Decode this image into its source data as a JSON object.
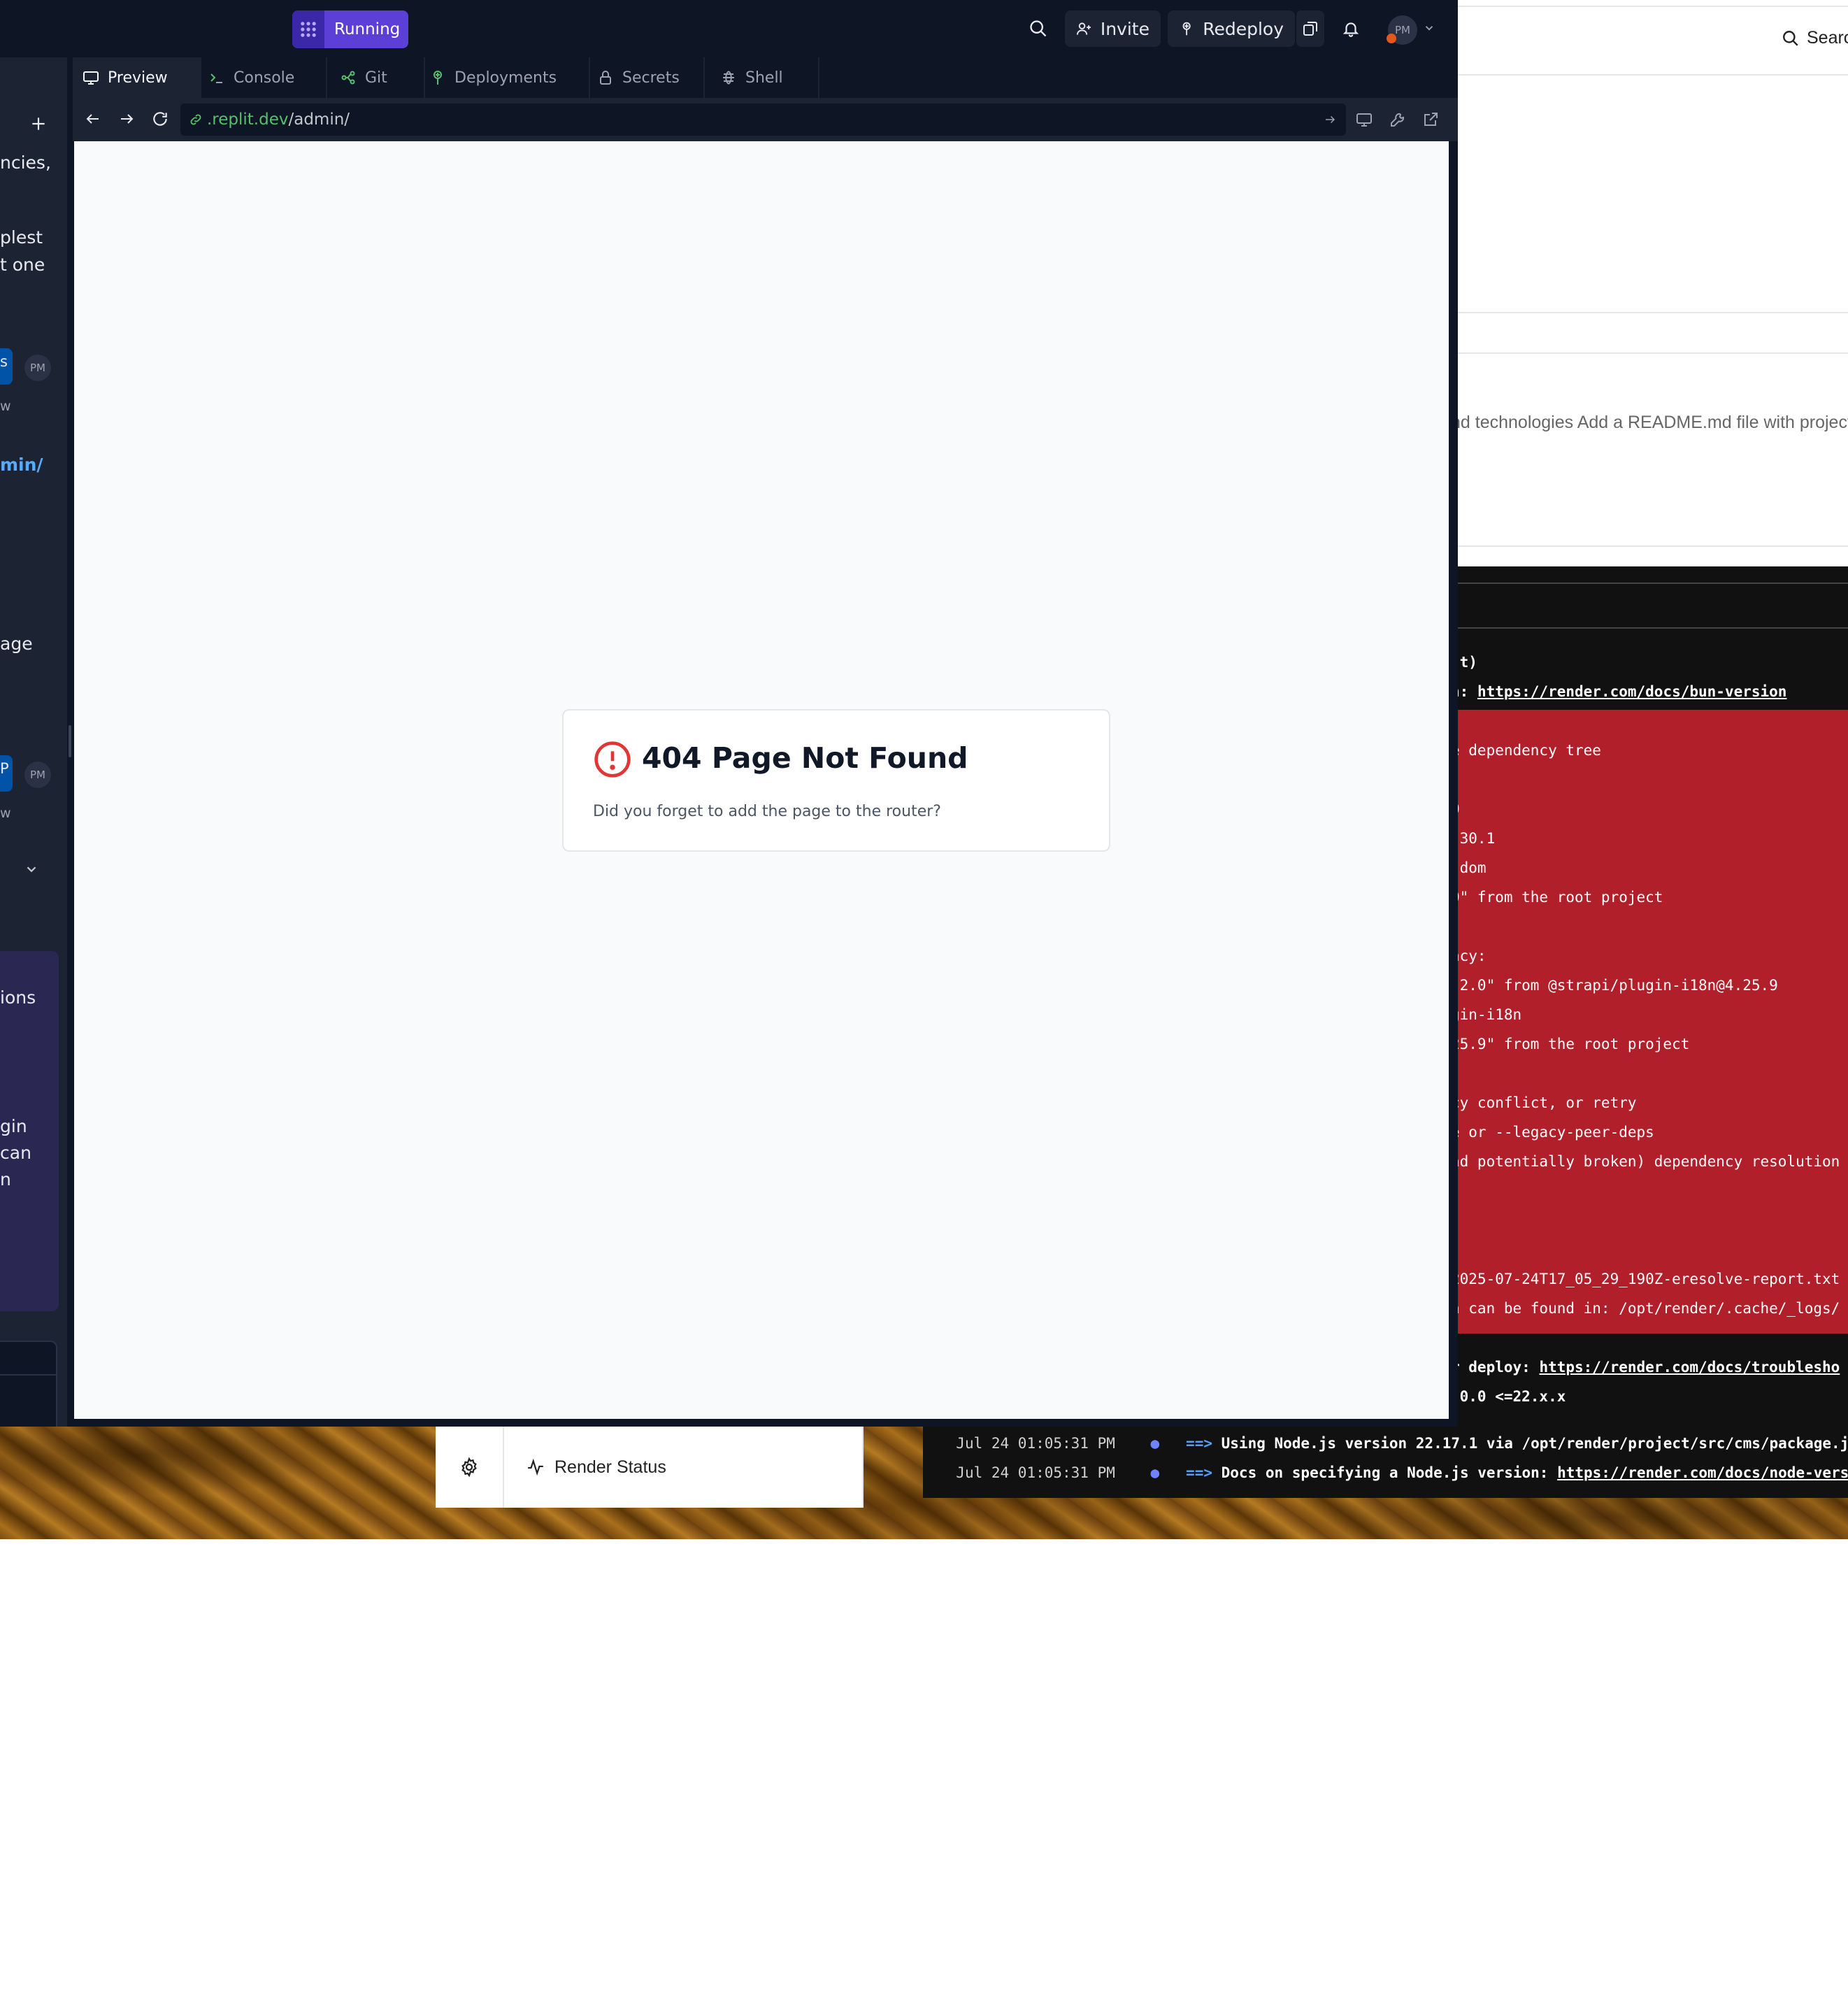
{
  "replit": {
    "run_label": "Running",
    "invite_label": "Invite",
    "redeploy_label": "Redeploy",
    "avatar_initials": "PM",
    "tabs": [
      {
        "label": "Preview",
        "active": true
      },
      {
        "label": "Console"
      },
      {
        "label": "Git"
      },
      {
        "label": "Deployments"
      },
      {
        "label": "Secrets"
      },
      {
        "label": "Shell"
      }
    ],
    "url_domain": ".replit.dev",
    "url_path": "/admin/",
    "left_panel": {
      "text_1": "ncies,",
      "text_2": "plest",
      "text_3": "t one",
      "msg_1_badge": "s",
      "msg_1_avatar": "PM",
      "msg_1_time": "w",
      "link_text": "min/",
      "text_4": "age",
      "msg_2_badge": "P",
      "msg_2_avatar": "PM",
      "msg_2_time": "w",
      "card_text_1": "ions",
      "card_text_2": "gin",
      "card_text_3": "can",
      "card_text_4": "n"
    },
    "not_found": {
      "title": "404 Page Not Found",
      "description": "Did you forget to add the page to the router?"
    }
  },
  "render": {
    "search_label": "Searc",
    "commit_text": "nd technologies Add a README.md file with project c",
    "sidebar_item": "Render Status",
    "log_lines": [
      {
        "text": ".t)",
        "bold": true
      },
      {
        "text": "n: ",
        "bold": true,
        "link": "https://render.com/docs/bun-version"
      },
      {
        "text": "e dependency tree"
      },
      {
        "text": "0"
      },
      {
        "text": ".30.1"
      },
      {
        "text": "-dom"
      },
      {
        "text": "0\" from the root project"
      },
      {
        "text": "ncy:"
      },
      {
        "text": ".2.0\" from @strapi/plugin-i18n@4.25.9"
      },
      {
        "text": "gin-i18n"
      },
      {
        "text": "25.9\" from the root project"
      },
      {
        "text": "cy conflict, or retry"
      },
      {
        "text": "e or --legacy-peer-deps"
      },
      {
        "text": "nd potentially broken) dependency resolution"
      },
      {
        "text": "2025-07-24T17_05_29_190Z-eresolve-report.txt"
      },
      {
        "text": "n can be found in: /opt/render/.cache/_logs/"
      },
      {
        "text": "r deploy: ",
        "bold": true,
        "link": "https://render.com/docs/troublesho"
      },
      {
        "text": ".0.0 <=22.x.x",
        "bold": true
      }
    ],
    "tail_lines": [
      {
        "time": "Jul 24 01:05:31 PM",
        "arrow": "==>",
        "message": "Using Node.js version 22.17.1 via /opt/render/project/src/cms/package.json"
      },
      {
        "time": "Jul 24 01:05:31 PM",
        "arrow": "==>",
        "message": "Docs on specifying a Node.js version: ",
        "link": "https://render.com/docs/node-version"
      }
    ]
  }
}
